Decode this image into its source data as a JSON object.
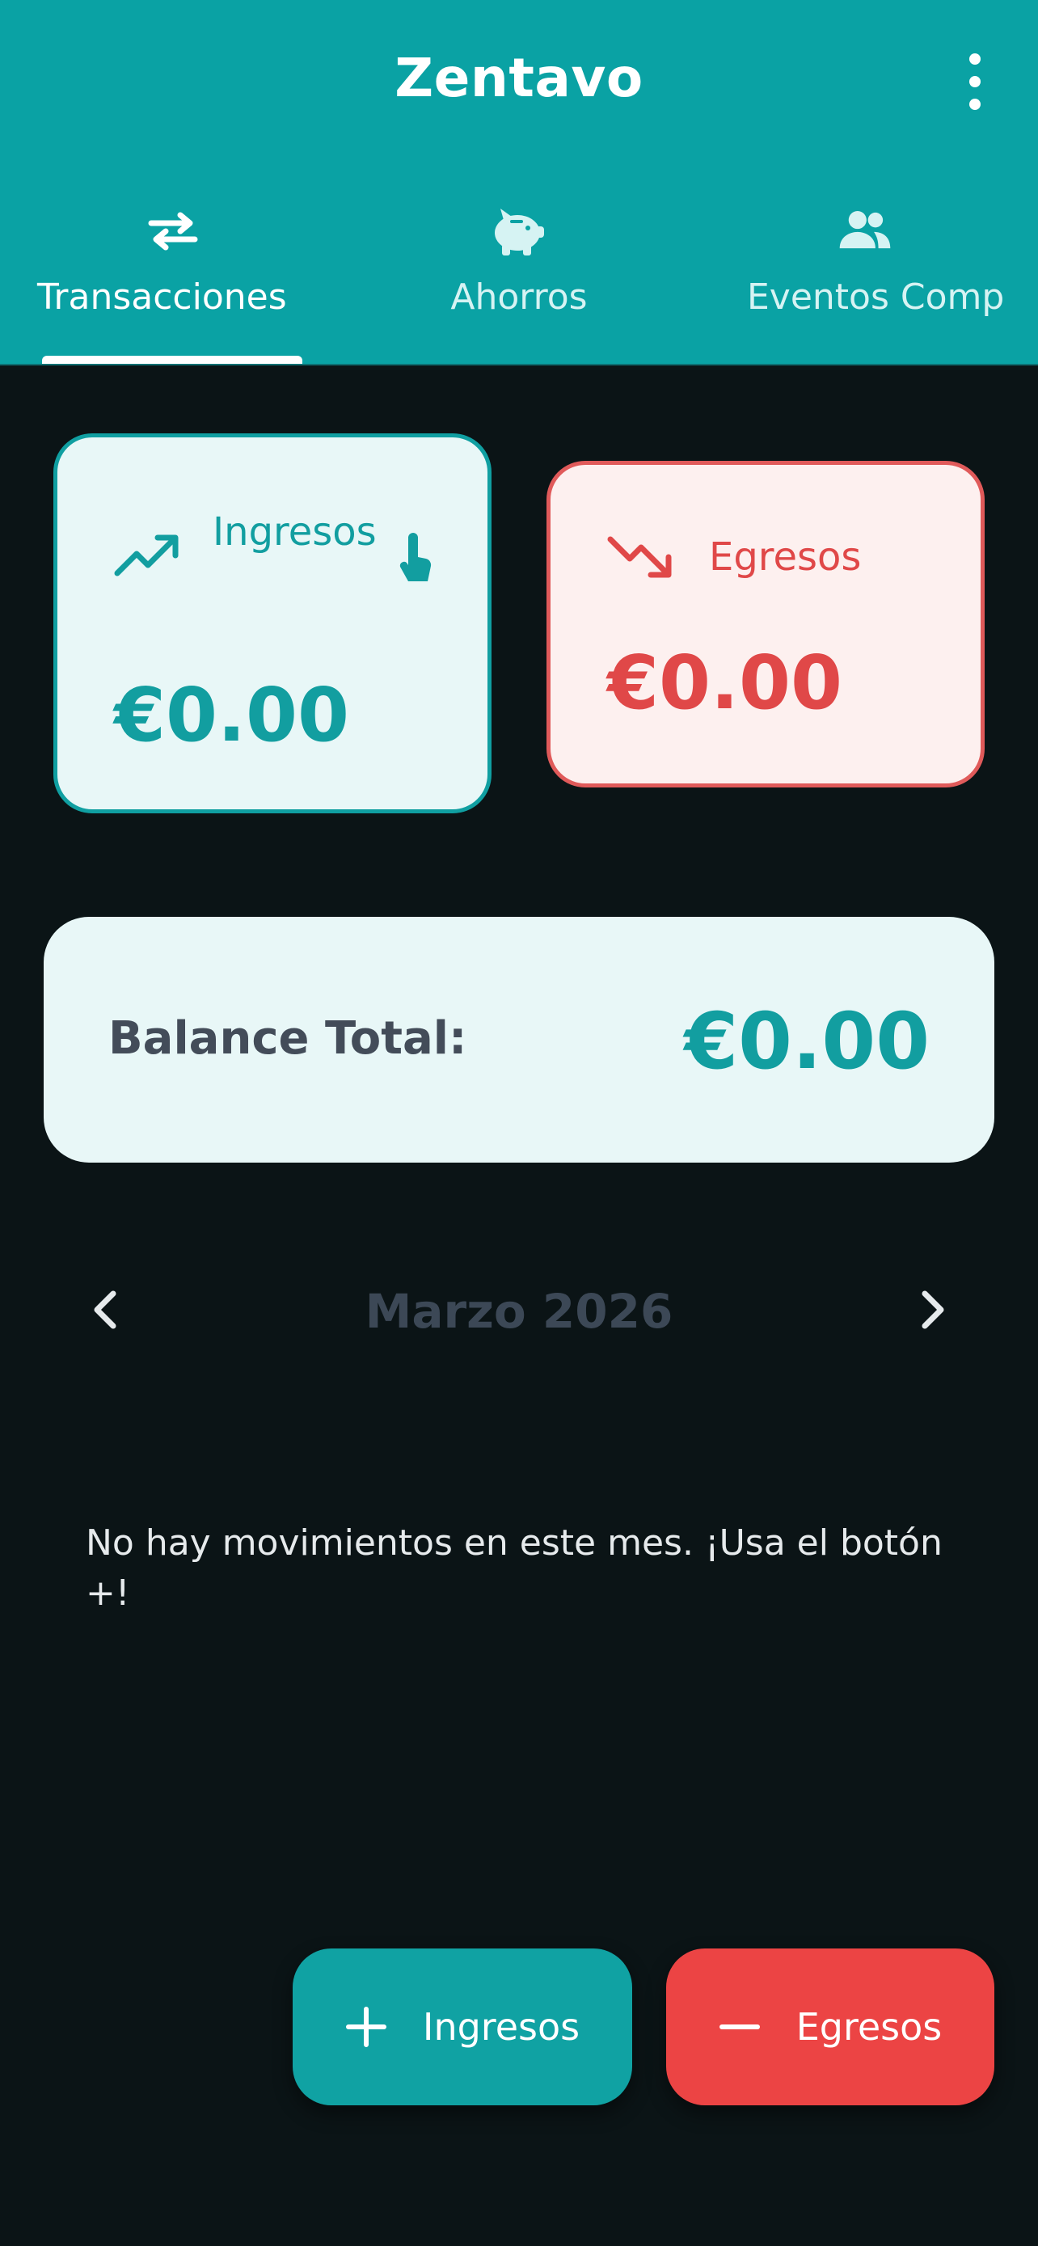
{
  "app": {
    "title": "Zentavo",
    "menu_icon": "more-vertical-icon"
  },
  "tabs": [
    {
      "label": "Transacciones",
      "icon": "swap-arrows-icon",
      "active": true
    },
    {
      "label": "Ahorros",
      "icon": "piggy-bank-icon",
      "active": false
    },
    {
      "label": "Eventos Comp",
      "icon": "group-icon",
      "active": false
    }
  ],
  "summary": {
    "income": {
      "label": "Ingresos",
      "amount": "€0.00",
      "icon": "trending-up-icon",
      "hint_icon": "touch-icon",
      "color": "#129ea0"
    },
    "expense": {
      "label": "Egresos",
      "amount": "€0.00",
      "icon": "trending-down-icon",
      "color": "#e04848"
    }
  },
  "balance": {
    "label": "Balance Total:",
    "amount": "€0.00"
  },
  "month_nav": {
    "label": "Marzo 2026",
    "prev_icon": "chevron-left-icon",
    "next_icon": "chevron-right-icon"
  },
  "empty_message": "No hay movimientos en este mes. ¡Usa el botón +!",
  "actions": {
    "income": {
      "label": "Ingresos",
      "icon": "plus-icon",
      "color": "#10a2a3"
    },
    "expense": {
      "label": "Egresos",
      "icon": "minus-icon",
      "color": "#ec4444"
    }
  },
  "colors": {
    "primary": "#0aa2a4",
    "background": "#0b1416",
    "danger": "#e04848"
  }
}
